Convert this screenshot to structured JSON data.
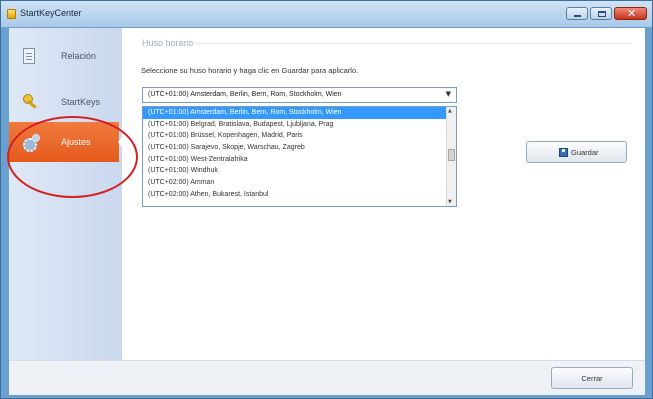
{
  "window": {
    "title": "StartKeyCenter"
  },
  "sidebar": {
    "items": [
      {
        "label": "Relación",
        "icon": "document-icon"
      },
      {
        "label": "StartKeys",
        "icon": "key-icon"
      },
      {
        "label": "Ajustes",
        "icon": "gear-icon",
        "active": true
      }
    ]
  },
  "content": {
    "section_title": "Huso horario",
    "instruction": "Seleccione su huso horario y haga clic en Guardar para aplicarlo.",
    "timezone_select": {
      "selected": "(UTC+01:00) Amsterdam, Berlin, Bern, Rom, Stockholm, Wien",
      "options": [
        "(UTC+01:00) Amsterdam, Berlin, Bern, Rom, Stockholm, Wien",
        "(UTC+01:00) Belgrad, Bratislava, Budapest, Ljubljana, Prag",
        "(UTC+01:00) Brüssel, Kopenhagen, Madrid, Paris",
        "(UTC+01:00) Sarajevo, Skopje, Warschau, Zagreb",
        "(UTC+01:00) West-Zentralafrika",
        "(UTC+01:00) Windhuk",
        "(UTC+02:00) Amman",
        "(UTC+02:00) Athen, Bukarest, Istanbul"
      ]
    },
    "save_label": "Guardar"
  },
  "footer": {
    "close_label": "Cerrar"
  },
  "colors": {
    "active_tab": "#e8641f",
    "list_selection": "#3399ff",
    "annotation_ring": "#d42020"
  }
}
